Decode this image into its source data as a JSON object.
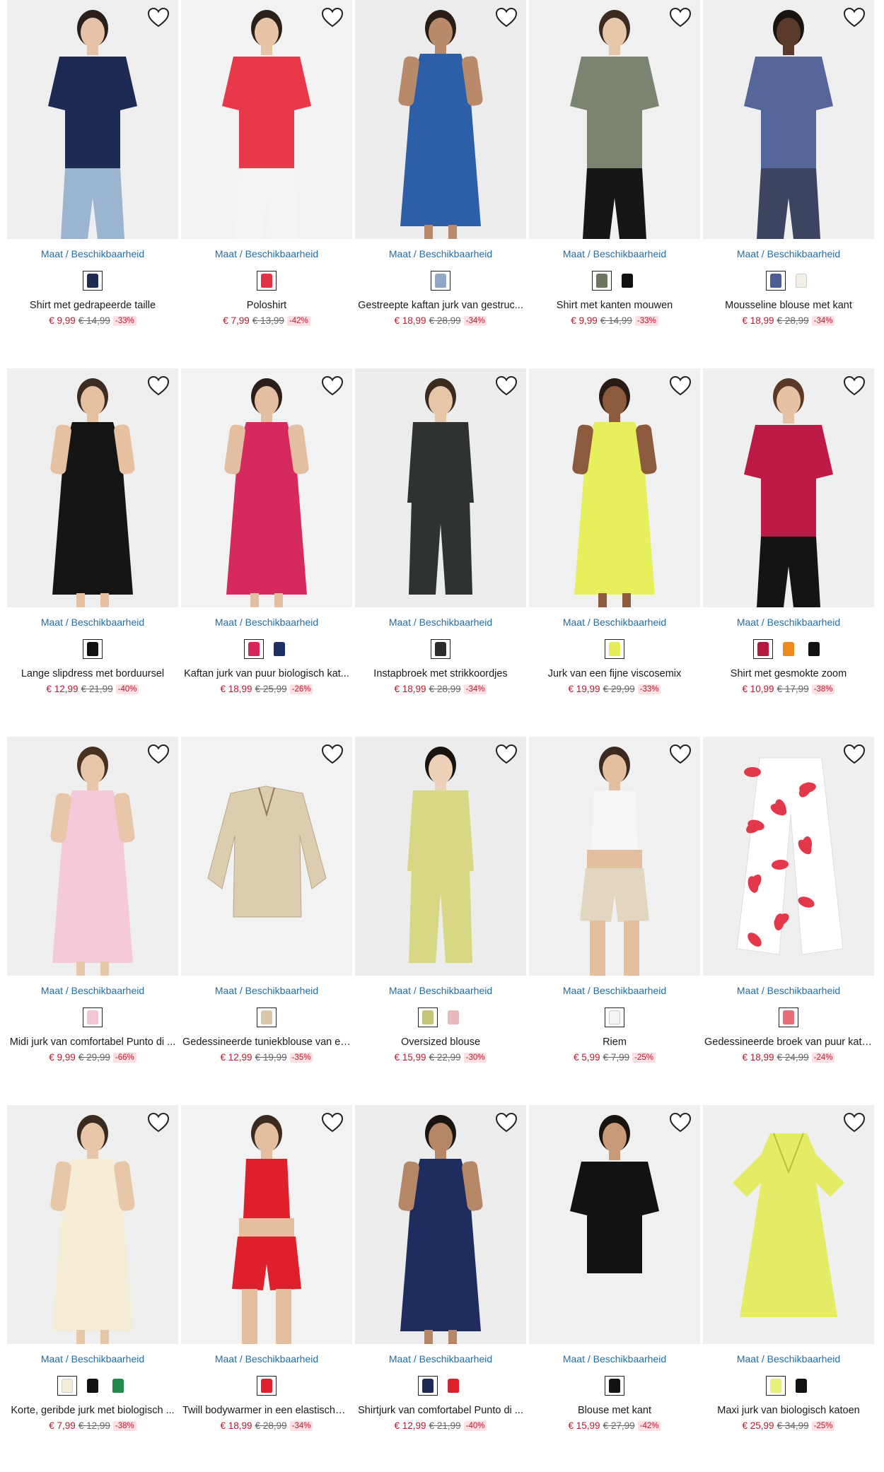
{
  "ui": {
    "size_link": "Maat / Beschikbaarheid",
    "wishlist_icon": "heart-outline-icon"
  },
  "products": [
    {
      "name": "Shirt met gedrapeerde taille",
      "price": "€ 9,99",
      "old_price": "€ 14,99",
      "discount": "-33%",
      "swatches": [
        "#1f2c4f"
      ],
      "model": {
        "top": "#1d2b52",
        "bottom": "#9bb4cf",
        "skin": "#e6c3a8",
        "hair": "#2a1f1a",
        "style": "shirt"
      }
    },
    {
      "name": "Poloshirt",
      "price": "€ 7,99",
      "old_price": "€ 13,99",
      "discount": "-42%",
      "swatches": [
        "#e03444"
      ],
      "model": {
        "top": "#e8384a",
        "bottom": "#f4f4f4",
        "skin": "#e8c4a7",
        "hair": "#2b211c",
        "style": "shirt"
      }
    },
    {
      "name": "Gestreepte kaftan jurk van gestruc...",
      "price": "€ 18,99",
      "old_price": "€ 28,99",
      "discount": "-34%",
      "swatches": [
        "#8fa8c8"
      ],
      "model": {
        "top": "#2c5fa8",
        "bottom": "#2c5fa8",
        "skin": "#b98a6a",
        "hair": "#2a1d16",
        "style": "dress"
      }
    },
    {
      "name": "Shirt met kanten mouwen",
      "price": "€ 9,99",
      "old_price": "€ 14,99",
      "discount": "-33%",
      "swatches": [
        "#6b7560",
        "#111111"
      ],
      "model": {
        "top": "#7b8470",
        "bottom": "#161616",
        "skin": "#e7c6aa",
        "hair": "#3a2a20",
        "style": "shirt"
      }
    },
    {
      "name": "Mousseline blouse met kant",
      "price": "€ 18,99",
      "old_price": "€ 28,99",
      "discount": "-34%",
      "swatches": [
        "#4e5e92",
        "#f1eee6"
      ],
      "model": {
        "top": "#56669a",
        "bottom": "#3c4460",
        "skin": "#5a3a2a",
        "hair": "#1a1410",
        "style": "shirt"
      }
    },
    {
      "name": "Lange slipdress met borduursel",
      "price": "€ 12,99",
      "old_price": "€ 21,99",
      "discount": "-40%",
      "swatches": [
        "#111111"
      ],
      "model": {
        "top": "#151515",
        "bottom": "#151515",
        "skin": "#e5c1a2",
        "hair": "#3b2b20",
        "style": "dress"
      }
    },
    {
      "name": "Kaftan jurk van puur biologisch kat...",
      "price": "€ 18,99",
      "old_price": "€ 25,99",
      "discount": "-26%",
      "swatches": [
        "#d6245a",
        "#1e2e66"
      ],
      "model": {
        "top": "#d62a5e",
        "bottom": "#d62a5e",
        "skin": "#e3bea0",
        "hair": "#2a1f1a",
        "style": "dress"
      }
    },
    {
      "name": "Instapbroek met strikkoordjes",
      "price": "€ 18,99",
      "old_price": "€ 28,99",
      "discount": "-34%",
      "swatches": [
        "#2a2d2a"
      ],
      "model": {
        "top": "#2f332f",
        "bottom": "#2f332f",
        "skin": "#e6c5a8",
        "hair": "#3a2a20",
        "style": "pants"
      }
    },
    {
      "name": "Jurk van een fijne viscosemix",
      "price": "€ 19,99",
      "old_price": "€ 29,99",
      "discount": "-33%",
      "swatches": [
        "#e5ec58"
      ],
      "model": {
        "top": "#e8ef5c",
        "bottom": "#e8ef5c",
        "skin": "#8c5a3c",
        "hair": "#2a1c14",
        "style": "dress"
      }
    },
    {
      "name": "Shirt met gesmokte zoom",
      "price": "€ 10,99",
      "old_price": "€ 17,99",
      "discount": "-38%",
      "swatches": [
        "#b5173e",
        "#ef8a1a",
        "#111111"
      ],
      "model": {
        "top": "#bd1a45",
        "bottom": "#141414",
        "skin": "#e5c2a4",
        "hair": "#5a3a26",
        "style": "shirt"
      }
    },
    {
      "name": "Midi jurk van comfortabel Punto di ...",
      "price": "€ 9,99",
      "old_price": "€ 29,99",
      "discount": "-66%",
      "swatches": [
        "#f2c5d6"
      ],
      "model": {
        "top": "#f4c9da",
        "bottom": "#f4c9da",
        "skin": "#e7c6aa",
        "hair": "#4a3020",
        "style": "dress"
      }
    },
    {
      "name": "Gedessineerde tuniekblouse van ee...",
      "price": "€ 12,99",
      "old_price": "€ 19,99",
      "discount": "-35%",
      "swatches": [
        "#d9c8a8"
      ],
      "model": {
        "top": "#dccdb0",
        "bottom": "#dccdb0",
        "skin": "",
        "hair": "",
        "style": "flat"
      }
    },
    {
      "name": "Oversized blouse",
      "price": "€ 15,99",
      "old_price": "€ 22,99",
      "discount": "-30%",
      "swatches": [
        "#c8c47a",
        "#e9b8b8"
      ],
      "model": {
        "top": "#d8d884",
        "bottom": "#d8d884",
        "skin": "#ecd0b8",
        "hair": "#1a1410",
        "style": "pants"
      }
    },
    {
      "name": "Riem",
      "price": "€ 5,99",
      "old_price": "€ 7,99",
      "discount": "-25%",
      "swatches": [
        "#f4f4f4"
      ],
      "model": {
        "top": "#f6f6f6",
        "bottom": "#e2d6c0",
        "skin": "#e3bf9f",
        "hair": "#3a2a20",
        "style": "shorts"
      }
    },
    {
      "name": "Gedessineerde broek van puur kato...",
      "price": "€ 18,99",
      "old_price": "€ 24,99",
      "discount": "-24%",
      "swatches": [
        "#e86b7a"
      ],
      "model": {
        "top": "#e2384a",
        "bottom": "#e2384a",
        "skin": "",
        "hair": "",
        "style": "flatpants"
      }
    },
    {
      "name": "Korte, geribde jurk met biologisch ...",
      "price": "€ 7,99",
      "old_price": "€ 12,99",
      "discount": "-38%",
      "swatches": [
        "#f3ecd6",
        "#111111",
        "#1f8a4a"
      ],
      "model": {
        "top": "#f4ecd4",
        "bottom": "#f4ecd4",
        "skin": "#e8c7a9",
        "hair": "#3a2a20",
        "style": "dress"
      }
    },
    {
      "name": "Twill bodywarmer in een elastische ...",
      "price": "€ 18,99",
      "old_price": "€ 28,99",
      "discount": "-34%",
      "swatches": [
        "#e0202c"
      ],
      "model": {
        "top": "#de1f2c",
        "bottom": "#de1f2c",
        "skin": "#e3bf9f",
        "hair": "#3a2a20",
        "style": "shorts"
      }
    },
    {
      "name": "Shirtjurk van comfortabel Punto di ...",
      "price": "€ 12,99",
      "old_price": "€ 21,99",
      "discount": "-40%",
      "swatches": [
        "#1e2a55",
        "#e0202c"
      ],
      "model": {
        "top": "#1f2c5e",
        "bottom": "#1f2c5e",
        "skin": "#b58767",
        "hair": "#1a1410",
        "style": "dress"
      }
    },
    {
      "name": "Blouse met kant",
      "price": "€ 15,99",
      "old_price": "€ 27,99",
      "discount": "-42%",
      "swatches": [
        "#111111"
      ],
      "model": {
        "top": "#121212",
        "bottom": "#f0f0f0",
        "skin": "#c99a78",
        "hair": "#1a1410",
        "style": "shirt"
      }
    },
    {
      "name": "Maxi jurk van biologisch katoen",
      "price": "€ 25,99",
      "old_price": "€ 34,99",
      "discount": "-25%",
      "swatches": [
        "#e7ef7a",
        "#111111"
      ],
      "model": {
        "top": "#e4ec66",
        "bottom": "#e4ec66",
        "skin": "",
        "hair": "",
        "style": "flatdress"
      }
    }
  ]
}
